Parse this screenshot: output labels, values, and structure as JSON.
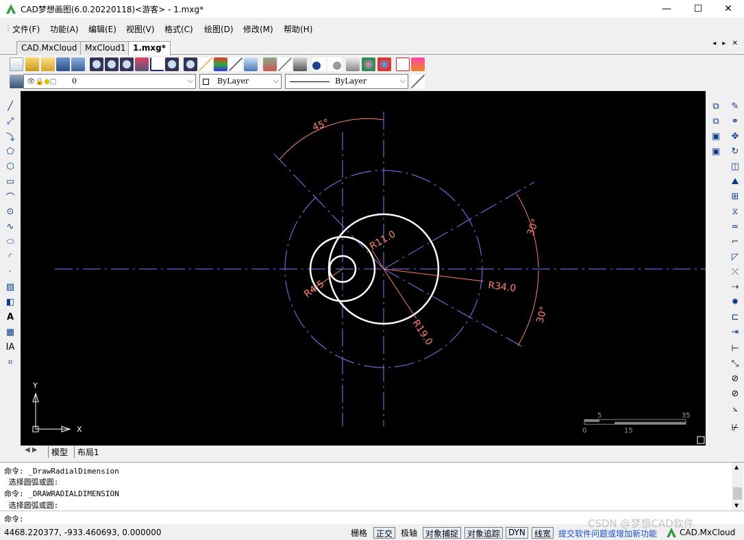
{
  "window": {
    "title": "CAD梦想画图(6.0.20220118)<游客> - 1.mxg*",
    "controls": [
      "—",
      "☐",
      "✕"
    ]
  },
  "menu": [
    "文件(F)",
    "功能(A)",
    "编辑(E)",
    "视图(V)",
    "格式(C)",
    "绘图(D)",
    "修改(M)",
    "帮助(H)"
  ],
  "tabs": [
    "CAD.MxCloud",
    "MxCloud1",
    "1.mxg*"
  ],
  "tab_nav": "◂ ▸ ✕",
  "layer_bar": {
    "layer_value": "0",
    "color_value": "ByLayer",
    "linetype_value": "ByLayer"
  },
  "drawing": {
    "dim_45": "45°",
    "dim_30_top": "30°",
    "dim_30_bottom": "30°",
    "r11": "R11.0",
    "r34": "R34.0",
    "r19": "R19.0",
    "r4_5": "R4.5",
    "ucs_y": "Y",
    "ucs_x": "X",
    "scale_top_left": "5",
    "scale_top_right": "35",
    "scale_bottom_left": "0",
    "scale_bottom_mid": "15"
  },
  "layout_tabs": [
    "模型",
    "布局1"
  ],
  "command_history": [
    "命令: _DrawRadialDimension",
    " 选择圆弧或圆:",
    "命令: _DRAWRADIALDIMENSION",
    " 选择圆弧或圆:"
  ],
  "command_prompt": "命令:",
  "status": {
    "coords": "4468.220377,  -933.460693,  0.000000",
    "toggles": [
      "栅格",
      "正交",
      "极轴",
      "对象捕捉",
      "对象追踪",
      "DYN",
      "线宽"
    ],
    "link": "提交软件问题或增加新功能",
    "brand": "CAD.MxCloud",
    "watermark": "CSDN @梦想CAD软件"
  },
  "colors": {
    "canvas": "#000000",
    "centerline": "#7c7cff",
    "dimension": "#ff8070",
    "geometry": "#ffffff"
  }
}
